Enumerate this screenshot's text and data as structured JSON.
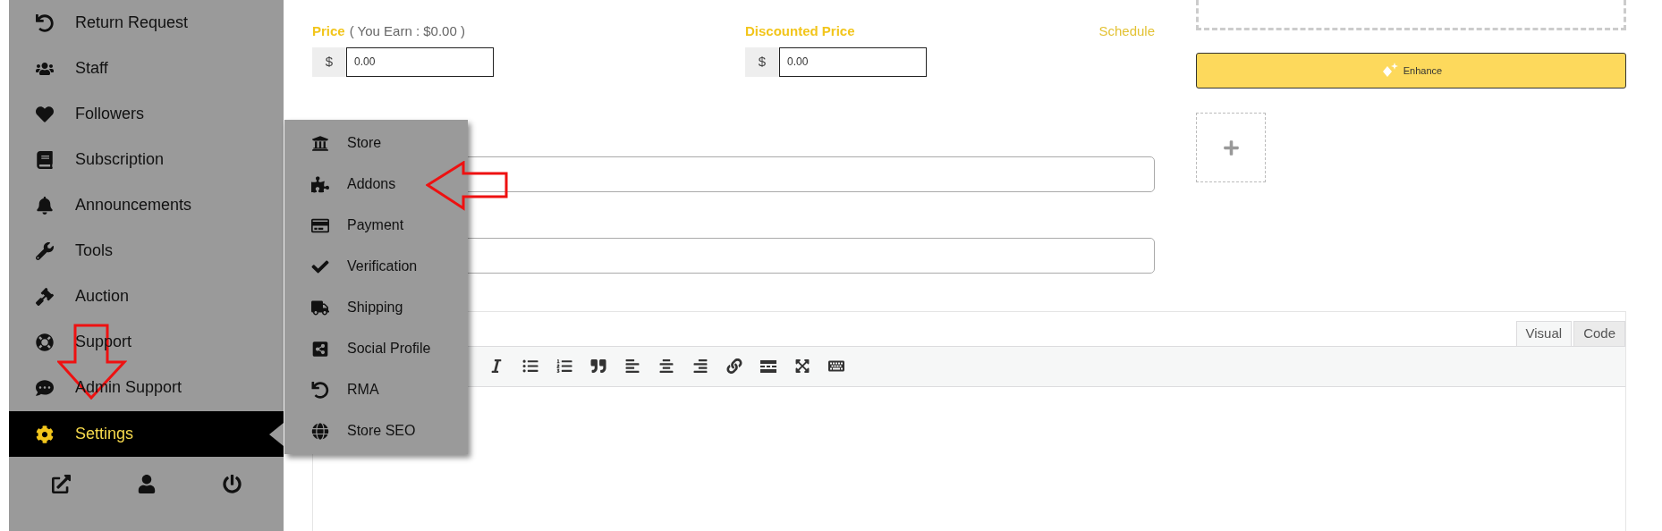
{
  "sidebar": {
    "items": [
      {
        "label": "Return Request",
        "selected": false
      },
      {
        "label": "Staff",
        "selected": false
      },
      {
        "label": "Followers",
        "selected": false
      },
      {
        "label": "Subscription",
        "selected": false
      },
      {
        "label": "Announcements",
        "selected": false
      },
      {
        "label": "Tools",
        "selected": false
      },
      {
        "label": "Auction",
        "selected": false
      },
      {
        "label": "Support",
        "selected": false
      },
      {
        "label": "Admin Support",
        "selected": false
      },
      {
        "label": "Settings",
        "selected": true
      }
    ]
  },
  "settings_menu": {
    "items": [
      {
        "label": "Store"
      },
      {
        "label": "Addons"
      },
      {
        "label": "Payment"
      },
      {
        "label": "Verification"
      },
      {
        "label": "Shipping"
      },
      {
        "label": "Social Profile"
      },
      {
        "label": "RMA"
      },
      {
        "label": "Store SEO"
      }
    ]
  },
  "price": {
    "label": "Price",
    "note": "( You Earn : $0.00 )",
    "currency": "$",
    "value": "0.00"
  },
  "discounted_price": {
    "label": "Discounted Price",
    "currency": "$",
    "value": "0.00",
    "link": "Schedule"
  },
  "enhance_button": {
    "label": "Enhance"
  },
  "editor": {
    "tabs": [
      {
        "label": "Visual",
        "selected": true
      },
      {
        "label": "Code",
        "selected": false
      }
    ]
  }
}
